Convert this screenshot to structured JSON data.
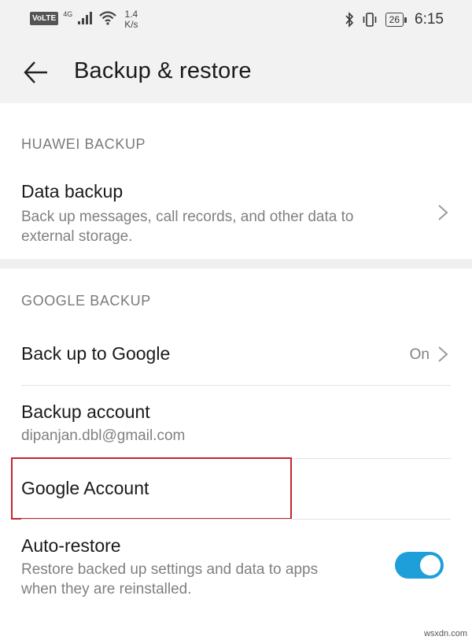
{
  "status_bar": {
    "volte": "VoLTE",
    "network_gen": "4G",
    "speed_value": "1.4",
    "speed_unit": "K/s",
    "battery": "26",
    "time": "6:15"
  },
  "header": {
    "title": "Backup & restore"
  },
  "huawei_backup": {
    "header": "HUAWEI BACKUP",
    "data_backup": {
      "title": "Data backup",
      "subtitle_line1": "Back up messages, call records, and other data to",
      "subtitle_line2": "external storage."
    }
  },
  "google_backup": {
    "header": "GOOGLE BACKUP",
    "back_up_to_google": {
      "title": "Back up to Google",
      "value": "On"
    },
    "backup_account": {
      "title": "Backup account",
      "subtitle": "dipanjan.dbl@gmail.com"
    },
    "google_account": {
      "title": "Google Account"
    },
    "auto_restore": {
      "title": "Auto-restore",
      "subtitle_line1": "Restore backed up settings and data to apps",
      "subtitle_line2": "when they are reinstalled.",
      "enabled": true
    }
  },
  "colors": {
    "accent": "#1e9fd9",
    "highlight": "#c2272d"
  },
  "watermark": "wsxdn.com"
}
